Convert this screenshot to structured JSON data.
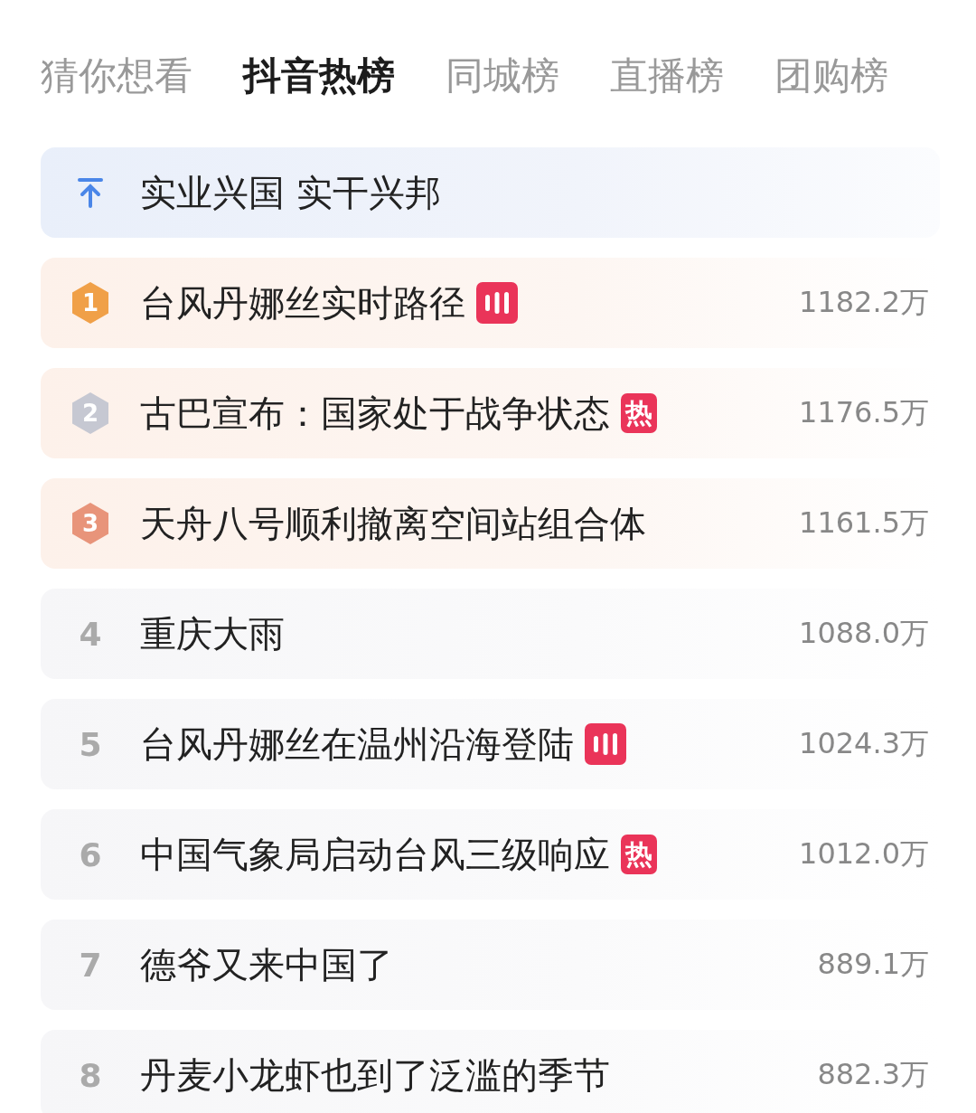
{
  "tabs": [
    {
      "label": "猜你想看",
      "selected": false
    },
    {
      "label": "抖音热榜",
      "selected": true
    },
    {
      "label": "同城榜",
      "selected": false
    },
    {
      "label": "直播榜",
      "selected": false
    },
    {
      "label": "团购榜",
      "selected": false
    }
  ],
  "pinned": {
    "title": "实业兴国 实干兴邦"
  },
  "items": [
    {
      "kind": "medal",
      "rank": "1",
      "color": "#f0a048",
      "title": "台风丹娜丝实时路径",
      "badge": {
        "kind": "live"
      },
      "heat": "1182.2万"
    },
    {
      "kind": "medal",
      "rank": "2",
      "color": "#c6c8d2",
      "title": "古巴宣布：国家处于战争状态",
      "badge": {
        "kind": "hot",
        "label": "热"
      },
      "heat": "1176.5万"
    },
    {
      "kind": "medal",
      "rank": "3",
      "color": "#e8947a",
      "title": "天舟八号顺利撤离空间站组合体",
      "heat": "1161.5万"
    },
    {
      "kind": "plain",
      "rank": "4",
      "title": "重庆大雨",
      "heat": "1088.0万"
    },
    {
      "kind": "plain",
      "rank": "5",
      "title": "台风丹娜丝在温州沿海登陆",
      "badge": {
        "kind": "live"
      },
      "heat": "1024.3万"
    },
    {
      "kind": "plain",
      "rank": "6",
      "title": "中国气象局启动台风三级响应",
      "badge": {
        "kind": "hot",
        "label": "热"
      },
      "heat": "1012.0万"
    },
    {
      "kind": "plain",
      "rank": "7",
      "title": "德爷又来中国了",
      "heat": "889.1万"
    },
    {
      "kind": "plain",
      "rank": "8",
      "title": "丹麦小龙虾也到了泛滥的季节",
      "heat": "882.3万"
    }
  ]
}
